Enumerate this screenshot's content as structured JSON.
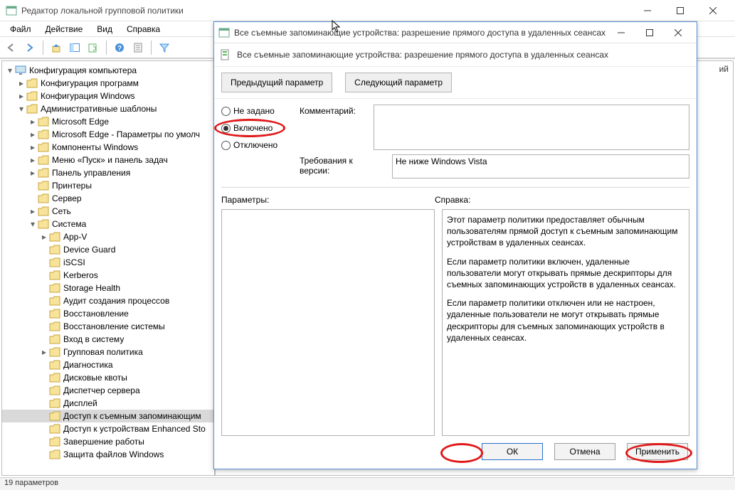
{
  "mainWindow": {
    "title": "Редактор локальной групповой политики",
    "menu": {
      "file": "Файл",
      "action": "Действие",
      "view": "Вид",
      "help": "Справка"
    }
  },
  "tree": {
    "root": "Конфигурация компьютера",
    "items": [
      {
        "indent": 1,
        "twist": ">",
        "label": "Конфигурация программ"
      },
      {
        "indent": 1,
        "twist": ">",
        "label": "Конфигурация Windows"
      },
      {
        "indent": 1,
        "twist": "v",
        "label": "Административные шаблоны"
      },
      {
        "indent": 2,
        "twist": ">",
        "label": "Microsoft Edge"
      },
      {
        "indent": 2,
        "twist": ">",
        "label": "Microsoft Edge - Параметры по умолч"
      },
      {
        "indent": 2,
        "twist": ">",
        "label": "Компоненты Windows"
      },
      {
        "indent": 2,
        "twist": ">",
        "label": "Меню «Пуск» и панель задач"
      },
      {
        "indent": 2,
        "twist": ">",
        "label": "Панель управления"
      },
      {
        "indent": 2,
        "twist": "",
        "label": "Принтеры"
      },
      {
        "indent": 2,
        "twist": "",
        "label": "Сервер"
      },
      {
        "indent": 2,
        "twist": ">",
        "label": "Сеть"
      },
      {
        "indent": 2,
        "twist": "v",
        "label": "Система"
      },
      {
        "indent": 3,
        "twist": ">",
        "label": "App-V"
      },
      {
        "indent": 3,
        "twist": "",
        "label": "Device Guard"
      },
      {
        "indent": 3,
        "twist": "",
        "label": "iSCSI"
      },
      {
        "indent": 3,
        "twist": "",
        "label": "Kerberos"
      },
      {
        "indent": 3,
        "twist": "",
        "label": "Storage Health"
      },
      {
        "indent": 3,
        "twist": "",
        "label": "Аудит создания процессов"
      },
      {
        "indent": 3,
        "twist": "",
        "label": "Восстановление"
      },
      {
        "indent": 3,
        "twist": "",
        "label": "Восстановление системы"
      },
      {
        "indent": 3,
        "twist": "",
        "label": "Вход в систему"
      },
      {
        "indent": 3,
        "twist": ">",
        "label": "Групповая политика"
      },
      {
        "indent": 3,
        "twist": "",
        "label": "Диагностика"
      },
      {
        "indent": 3,
        "twist": "",
        "label": "Дисковые квоты"
      },
      {
        "indent": 3,
        "twist": "",
        "label": "Диспетчер сервера"
      },
      {
        "indent": 3,
        "twist": "",
        "label": "Дисплей"
      },
      {
        "indent": 3,
        "twist": "",
        "label": "Доступ к съемным запоминающим",
        "selected": true
      },
      {
        "indent": 3,
        "twist": "",
        "label": "Доступ к устройствам Enhanced Sto"
      },
      {
        "indent": 3,
        "twist": "",
        "label": "Завершение работы"
      },
      {
        "indent": 3,
        "twist": "",
        "label": "Защита файлов Windows"
      }
    ]
  },
  "rightPane": {
    "peek": "ий"
  },
  "statusbar": {
    "text": "19 параметров"
  },
  "dialog": {
    "title": "Все съемные запоминающие устройства: разрешение прямого доступа в удаленных сеансах",
    "headerText": "Все съемные запоминающие устройства: разрешение прямого доступа в удаленных сеансах",
    "nav": {
      "prev": "Предыдущий параметр",
      "next": "Следующий параметр"
    },
    "radios": {
      "notConfigured": "Не задано",
      "enabled": "Включено",
      "disabled": "Отключено",
      "selected": "enabled"
    },
    "commentLabel": "Комментарий:",
    "commentValue": "",
    "requirementsLabel": "Требования к версии:",
    "requirementsValue": "Не ниже Windows Vista",
    "paramsLabel": "Параметры:",
    "helpLabel": "Справка:",
    "help": {
      "p1": "Этот параметр политики предоставляет обычным пользователям прямой доступ к съемным запоминающим устройствам в удаленных сеансах.",
      "p2": "Если параметр политики включен, удаленные пользователи могут открывать прямые дескрипторы для съемных запоминающих устройств в удаленных сеансах.",
      "p3": "Если параметр политики отключен или не настроен, удаленные пользователи не могут открывать прямые дескрипторы для съемных запоминающих устройств в удаленных сеансах."
    },
    "buttons": {
      "ok": "ОК",
      "cancel": "Отмена",
      "apply": "Применить"
    }
  }
}
